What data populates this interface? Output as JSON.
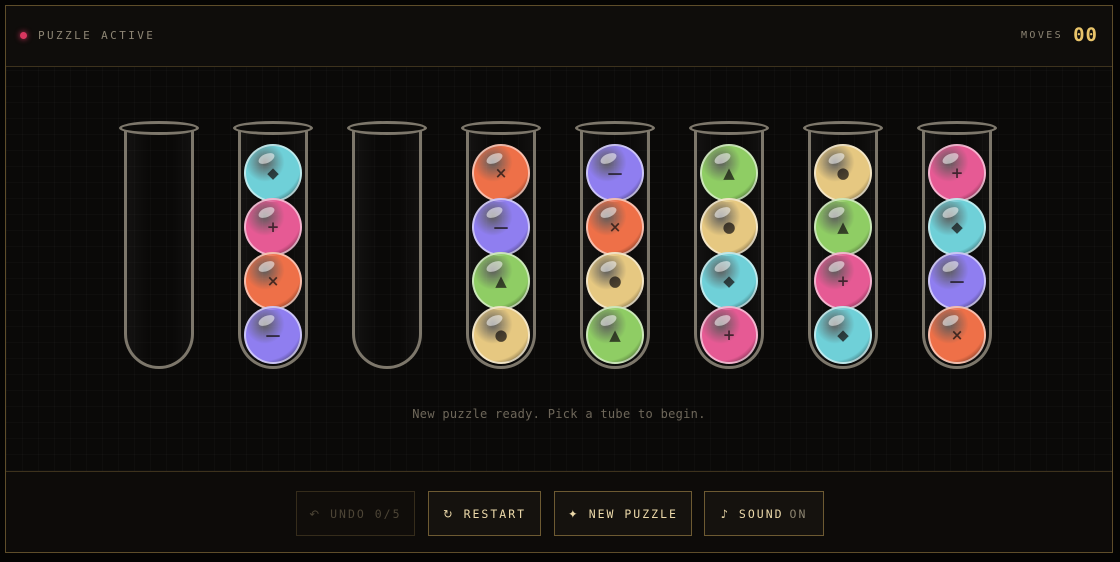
{
  "header": {
    "status_text": "PUZZLE ACTIVE",
    "moves_label": "MOVES",
    "moves_value": "00",
    "status_color": "#d9365f",
    "accent_color": "#e9c46a"
  },
  "board": {
    "hint": "New puzzle ready. Pick a tube to begin.",
    "ball_types": {
      "cyan": {
        "color": "#6fd0d8",
        "symbol": "◆"
      },
      "pink": {
        "color": "#e65a94",
        "symbol": "+"
      },
      "orange": {
        "color": "#ee7048",
        "symbol": "×"
      },
      "purple": {
        "color": "#8f7ef0",
        "symbol": "—"
      },
      "green": {
        "color": "#8fcd64",
        "symbol": "▲"
      },
      "yellow": {
        "color": "#e6c881",
        "symbol": "●"
      }
    },
    "tubes": [
      {
        "balls_top_to_bottom": []
      },
      {
        "balls_top_to_bottom": [
          "cyan",
          "pink",
          "orange",
          "purple"
        ]
      },
      {
        "balls_top_to_bottom": []
      },
      {
        "balls_top_to_bottom": [
          "orange",
          "purple",
          "green",
          "yellow"
        ]
      },
      {
        "balls_top_to_bottom": [
          "purple",
          "orange",
          "yellow",
          "green"
        ]
      },
      {
        "balls_top_to_bottom": [
          "green",
          "yellow",
          "cyan",
          "pink"
        ]
      },
      {
        "balls_top_to_bottom": [
          "yellow",
          "green",
          "pink",
          "cyan"
        ]
      },
      {
        "balls_top_to_bottom": [
          "pink",
          "cyan",
          "purple",
          "orange"
        ]
      }
    ]
  },
  "footer": {
    "undo": {
      "icon": "↶",
      "label": "UNDO 0/5",
      "disabled": true
    },
    "restart": {
      "icon": "↻",
      "label": "RESTART"
    },
    "new_puzzle": {
      "icon": "✦",
      "label": "NEW PUZZLE"
    },
    "sound": {
      "icon": "♪",
      "label": "SOUND",
      "state": "ON"
    }
  }
}
